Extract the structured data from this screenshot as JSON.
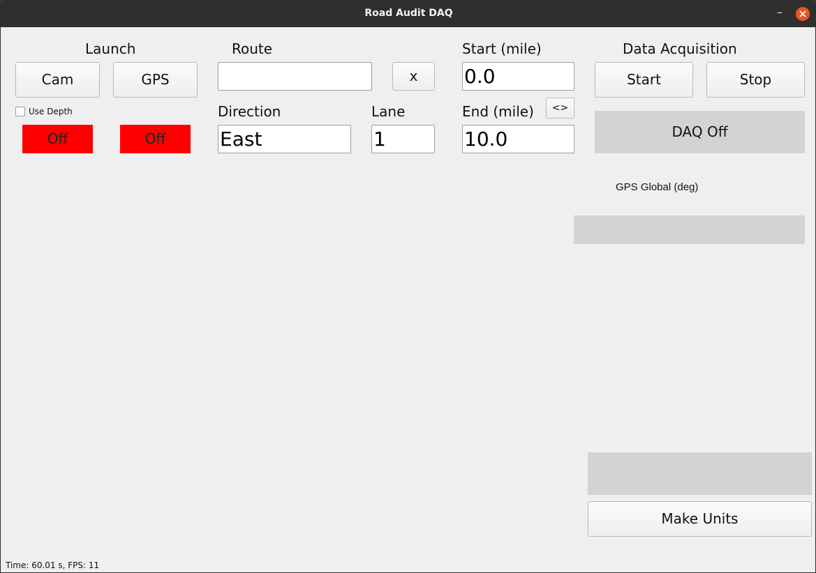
{
  "window": {
    "title": "Road Audit DAQ"
  },
  "launch": {
    "heading": "Launch",
    "cam_button": "Cam",
    "gps_button": "GPS",
    "use_depth_label": "Use Depth",
    "use_depth_checked": false,
    "cam_status": "Off",
    "gps_status": "Off"
  },
  "route": {
    "heading": "Route",
    "value": "",
    "clear_button": "x"
  },
  "direction": {
    "label": "Direction",
    "value": "East"
  },
  "lane": {
    "label": "Lane",
    "value": "1"
  },
  "start_mile": {
    "label": "Start (mile)",
    "value": "0.0"
  },
  "end_mile": {
    "label": "End (mile)",
    "value": "10.0"
  },
  "swap_button": "<>",
  "daq": {
    "heading": "Data Acquisition",
    "start_button": "Start",
    "stop_button": "Stop",
    "status": "DAQ Off"
  },
  "gps_global": {
    "label": "GPS Global (deg)",
    "value": ""
  },
  "units_status": "",
  "make_units_button": "Make Units",
  "status_bar": "Time: 60.01 s, FPS: 11",
  "colors": {
    "status_off": "#ff0000",
    "panel_gray": "#d3d3d3",
    "close_orange": "#e95420"
  }
}
